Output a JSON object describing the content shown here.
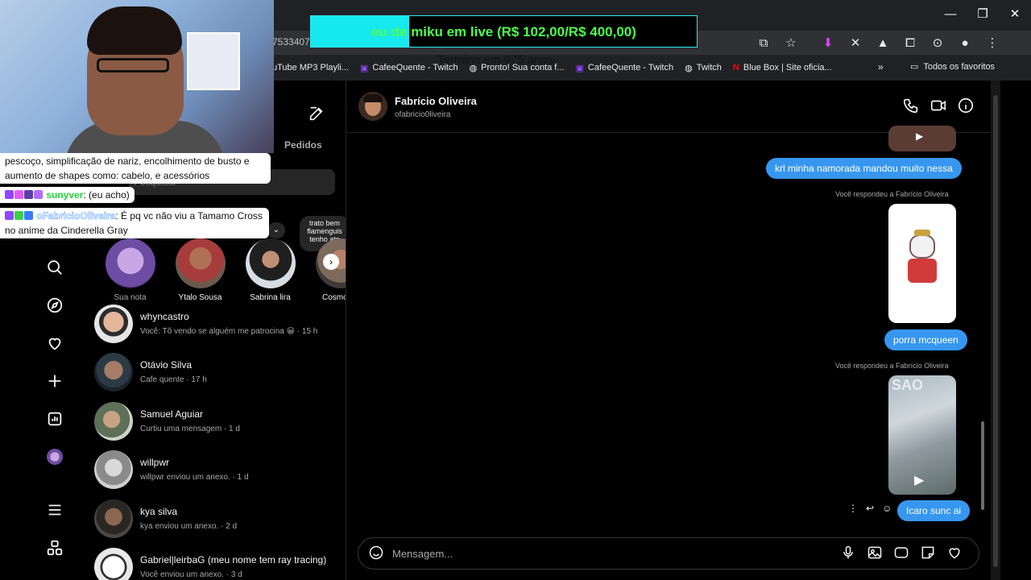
{
  "browser": {
    "url_fragment": "7533407",
    "bookmarks": [
      {
        "label": "uTube MP3 Playli...",
        "icon": "music-icon"
      },
      {
        "label": "CafeeQuente - Twitch",
        "icon": "twitch-icon"
      },
      {
        "label": "Pronto! Sua conta f...",
        "icon": "globe-icon"
      },
      {
        "label": "CafeeQuente - Twitch",
        "icon": "twitch-icon"
      },
      {
        "label": "Twitch",
        "icon": "globe-icon"
      },
      {
        "label": "Blue Box | Site oficia...",
        "icon": "netflix-icon"
      }
    ],
    "more_bookmarks": "»",
    "all_bookmarks": "Todos os favoritos"
  },
  "overlay": {
    "goal_text_prefix": "eu de",
    "goal_text_rest": " miku em live (R$ 102,00/R$ 400,00)",
    "goal_progress": 0.255,
    "goal_sub": "Termina em 975 anos",
    "goal_fill_color": "#17e9f0",
    "goal_text_color": "#4dff4d"
  },
  "stream_chat": [
    {
      "text": "pescoço, simplificação de nariz, encolhimento de busto e aumento de shapes como: cabelo, e acessórios"
    },
    {
      "user": "sunyver",
      "text": ": (eu acho)"
    },
    {
      "user": "oFabricioOliveira",
      "text": ": É pq vc não viu a Tamamo Cross no anime da Cinderella Gray"
    }
  ],
  "messages_list": {
    "tab_requests": "Pedidos",
    "search_placeholder": "Pesquisar",
    "note_bubble": "trato bem flamenguis tenho ate",
    "stories": [
      {
        "name": "Sua nota"
      },
      {
        "name": "Ytalo Sousa"
      },
      {
        "name": "Sabrina lira"
      },
      {
        "name": "Cosmos 1"
      }
    ],
    "conversations": [
      {
        "name": "whyncastro",
        "preview": "Você: Tô vendo se alguém me patrocina 😀 · 15 h"
      },
      {
        "name": "Otávio Silva",
        "preview": "Cafe quente · 17 h"
      },
      {
        "name": "Samuel Aguiar",
        "preview": "Curtiu uma mensagem · 1 d"
      },
      {
        "name": "willpwr",
        "preview": "willpwr enviou um anexo. · 1 d"
      },
      {
        "name": "kya silva",
        "preview": "kya enviou um anexo. · 2 d"
      },
      {
        "name": "Gabriel|leirbaG (meu nome tem ray tracing)",
        "preview": "Você enviou um anexo. · 3 d"
      }
    ]
  },
  "chat": {
    "contact_name": "Fabrício Oliveira",
    "contact_username": "ofabricio0liveira",
    "messages": [
      {
        "text": "krl minha namorada mandou muito nessa"
      },
      {
        "replied_label": "Você respondeu a Fabrício Oliveira"
      },
      {
        "text": "porra mcqueen"
      },
      {
        "replied_label": "Você respondeu a Fabrício Oliveira"
      },
      {
        "reel_title": "SAO"
      },
      {
        "text": "Icaro sunc ai"
      }
    ],
    "composer_placeholder": "Mensagem..."
  },
  "colors": {
    "accent_bubble": "#3797f0",
    "background": "#000000",
    "muted_text": "#a8a8a8"
  }
}
